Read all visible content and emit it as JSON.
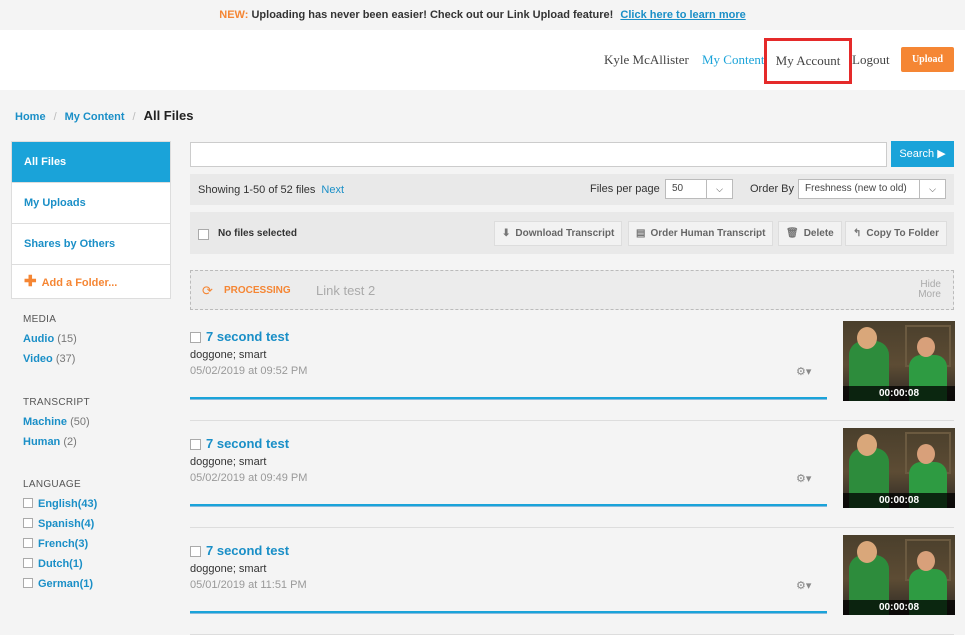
{
  "banner": {
    "new_label": "NEW:",
    "text": "Uploading has never been easier! Check out our Link Upload feature!",
    "link": "Click here to learn more"
  },
  "nav": {
    "user": "Kyle McAllister",
    "my_content": "My Content",
    "my_account": "My Account",
    "logout": "Logout",
    "upload": "Upload"
  },
  "breadcrumb": {
    "home": "Home",
    "my_content": "My Content",
    "current": "All Files"
  },
  "sidebar": {
    "items": [
      {
        "label": "All Files"
      },
      {
        "label": "My Uploads"
      },
      {
        "label": "Shares by Others"
      }
    ],
    "add_folder": "Add a Folder..."
  },
  "facets": {
    "media": {
      "header": "MEDIA",
      "rows": [
        {
          "label": "Audio",
          "count": "(15)"
        },
        {
          "label": "Video",
          "count": "(37)"
        }
      ]
    },
    "transcript": {
      "header": "TRANSCRIPT",
      "rows": [
        {
          "label": "Machine",
          "count": "(50)"
        },
        {
          "label": "Human",
          "count": "(2)"
        }
      ]
    },
    "language": {
      "header": "LANGUAGE",
      "rows": [
        {
          "label": "English(43)"
        },
        {
          "label": "Spanish(4)"
        },
        {
          "label": "French(3)"
        },
        {
          "label": "Dutch(1)"
        },
        {
          "label": "German(1)"
        }
      ]
    }
  },
  "search": {
    "placeholder": "",
    "button": "Search ▶"
  },
  "pager": {
    "showing": "Showing 1-50 of 52 files",
    "next": "Next",
    "files_per_page_label": "Files per page",
    "files_per_page": "50",
    "order_by_label": "Order By",
    "order_by": "Freshness (new to old)"
  },
  "actions": {
    "no_selection": "No files selected",
    "download": "Download Transcript",
    "order_human": "Order Human Transcript",
    "delete": "Delete",
    "copy": "Copy To Folder"
  },
  "processing": {
    "status": "PROCESSING",
    "name": "Link test 2",
    "hide": "Hide",
    "more": "More"
  },
  "files": [
    {
      "title": "7 second test",
      "tags": "doggone; smart",
      "date": "05/02/2019 at 09:52 PM",
      "duration": "00:00:08"
    },
    {
      "title": "7 second test",
      "tags": "doggone; smart",
      "date": "05/02/2019 at 09:49 PM",
      "duration": "00:00:08"
    },
    {
      "title": "7 second test",
      "tags": "doggone; smart",
      "date": "05/01/2019 at 11:51 PM",
      "duration": "00:00:08"
    }
  ],
  "colors": {
    "accent": "#1aa3d9",
    "brand_orange": "#f58634",
    "highlight": "#e52a2a"
  }
}
